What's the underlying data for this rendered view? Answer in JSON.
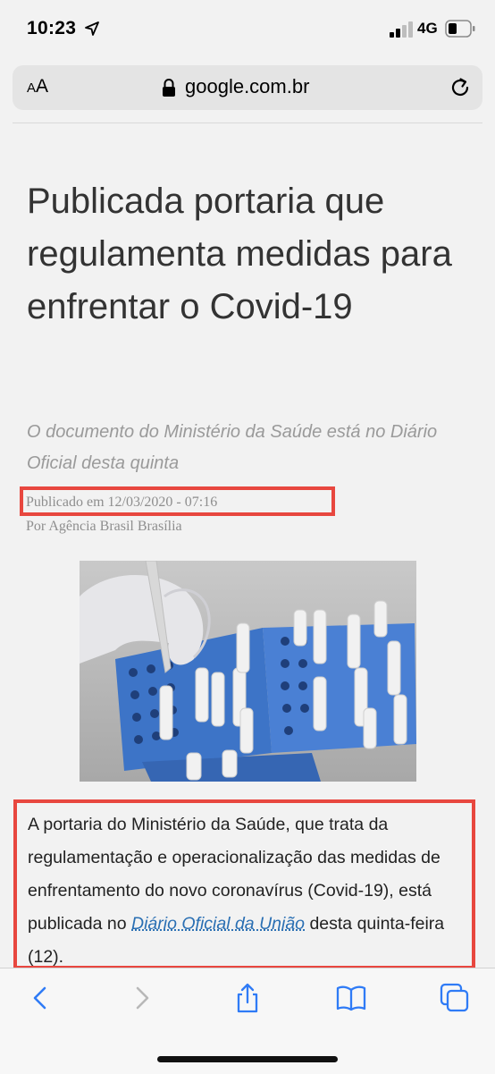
{
  "status_bar": {
    "time": "10:23",
    "network": "4G",
    "icons": [
      "location-arrow-icon",
      "signal-icon",
      "battery-icon"
    ]
  },
  "address_bar": {
    "text_size_label_small": "A",
    "text_size_label_large": "A",
    "url": "google.com.br",
    "icons": [
      "lock-icon",
      "reload-icon"
    ]
  },
  "article": {
    "headline": "Publicada portaria que regulamenta medidas para enfrentar o Covid-19",
    "subtitle": "O documento do Ministério da Saúde está no Diário Oficial desta quinta",
    "published": "Publicado em 12/03/2020 - 07:16",
    "author": "Por Agência Brasil Brasília",
    "paragraph_before_link": "A portaria do Ministério da Saúde, que trata da regulamentação e operacionalização das medidas de enfrentamento do novo coronavírus (Covid-19), está publicada no ",
    "link_text": "Diário Oficial da União",
    "paragraph_after_link": " desta quinta-feira (12)."
  },
  "colors": {
    "highlight": "#e8473f",
    "link": "#2a6fb3",
    "toolbar_icon": "#2f7bf6",
    "toolbar_icon_disabled": "#b8b8b8"
  },
  "toolbar": {
    "icons": [
      "back-icon",
      "forward-icon",
      "share-icon",
      "bookmarks-icon",
      "tabs-icon"
    ]
  }
}
